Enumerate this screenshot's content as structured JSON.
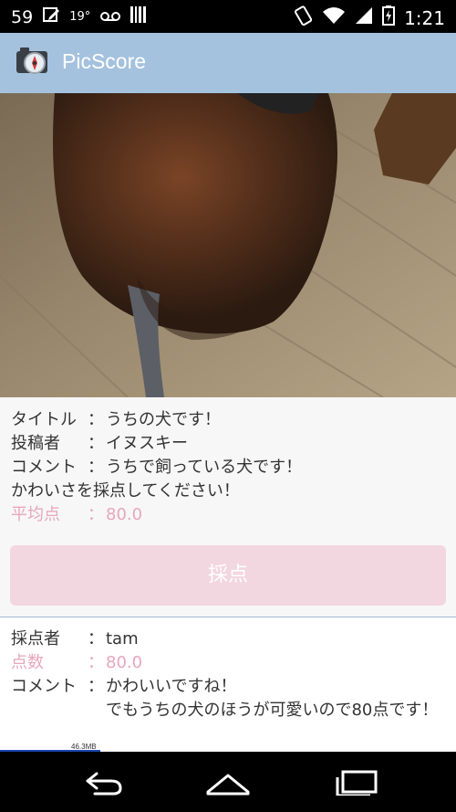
{
  "status_bar": {
    "left_number": "59",
    "temperature": "19°",
    "time": "1:21",
    "icons": [
      "edit-icon",
      "voicemail-icon",
      "barcode-icon",
      "rotate-icon",
      "wifi-icon",
      "signal-icon",
      "battery-icon"
    ]
  },
  "app": {
    "title": "PicScore",
    "icon": "camera-compass-icon"
  },
  "post": {
    "title_label": "タイトル",
    "title_value": "うちの犬です！",
    "poster_label": "投稿者",
    "poster_value": "イヌスキー",
    "comment_label": "コメント",
    "comment_value_line1": "うちで飼っている犬です！",
    "comment_value_line2": "かわいさを採点してください！",
    "avg_label": "平均点",
    "avg_value": "80.0",
    "separator": "："
  },
  "score_button": {
    "label": "採点"
  },
  "review": {
    "scorer_label": "採点者",
    "scorer_value": "tam",
    "score_label": "点数",
    "score_value": "80.0",
    "comment_label": "コメント",
    "comment_line1": "かわいいですね！",
    "comment_line2": "でもうちの犬のほうが可愛いので80点です！",
    "separator": "："
  },
  "memory_indicator": {
    "text": "46.3MB"
  },
  "colors": {
    "appbar": "#a4c2de",
    "accent_pink": "#e8a6bd",
    "button_pink": "#f2d6e0"
  },
  "nav": {
    "icons": [
      "back-icon",
      "home-icon",
      "recents-icon"
    ]
  }
}
